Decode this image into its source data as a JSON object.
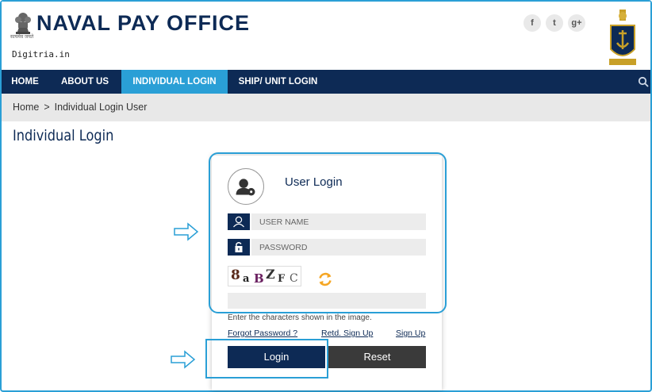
{
  "header": {
    "title": "NAVAL PAY OFFICE",
    "emblem_motto": "सत्यमेव जयते",
    "watermark": "Digitria.in",
    "social": [
      {
        "icon": "facebook-icon",
        "glyph": "f"
      },
      {
        "icon": "twitter-icon",
        "glyph": "t"
      },
      {
        "icon": "google-plus-icon",
        "glyph": "g+"
      }
    ]
  },
  "nav": {
    "items": [
      {
        "label": "HOME",
        "active": false
      },
      {
        "label": "ABOUT US",
        "active": false
      },
      {
        "label": "INDIVIDUAL LOGIN",
        "active": true
      },
      {
        "label": "SHIP/ UNIT LOGIN",
        "active": false
      }
    ],
    "search_icon": "search-icon"
  },
  "breadcrumb": {
    "home": "Home",
    "separator": ">",
    "current": "Individual Login User"
  },
  "page": {
    "title": "Individual Login"
  },
  "login": {
    "title": "User Login",
    "username_placeholder": "USER NAME",
    "password_placeholder": "PASSWORD",
    "captcha_chars": [
      "8",
      "a",
      "B",
      "Z",
      "F",
      "C"
    ],
    "captcha_hint": "Enter the characters shown in the image.",
    "forgot_password": "Forgot Password ?",
    "retd_signup": "Retd. Sign Up",
    "signup": "Sign Up",
    "login_button": "Login",
    "reset_button": "Reset"
  },
  "colors": {
    "primary": "#0d2a55",
    "accent": "#2a9fd6",
    "reset_button": "#3a3a3a",
    "field_bg": "#ececec",
    "refresh_icon": "#f5a623"
  }
}
